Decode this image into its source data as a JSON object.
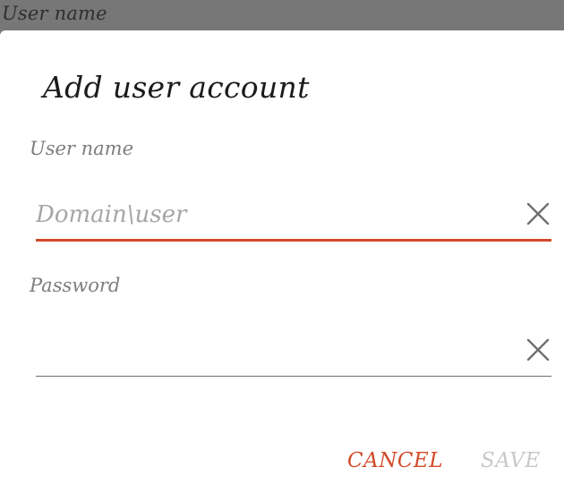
{
  "backdrop": {
    "label": "User name"
  },
  "dialog": {
    "title": "Add user account",
    "username": {
      "label": "User name",
      "value": "",
      "placeholder": "Domain\\user",
      "clear_icon": "close-icon"
    },
    "password": {
      "label": "Password",
      "value": "",
      "placeholder": "",
      "clear_icon": "close-icon"
    },
    "actions": {
      "cancel_label": "CANCEL",
      "save_label": "SAVE",
      "save_enabled": false
    }
  },
  "colors": {
    "accent": "#d24a2a",
    "disabled": "#c8c8c8",
    "label": "#7d7d7d",
    "backdrop": "#777777"
  }
}
